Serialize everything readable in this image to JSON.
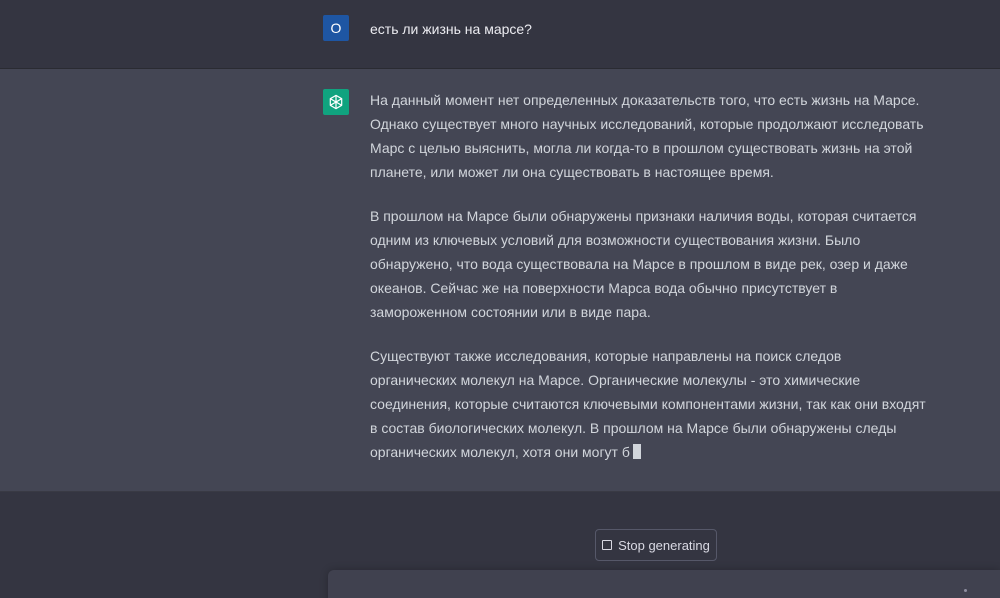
{
  "user_message": {
    "avatar_letter": "O",
    "text": "есть ли жизнь на марсе?"
  },
  "assistant_message": {
    "paragraphs": [
      "На данный момент нет определенных доказательств того, что есть жизнь на Марсе. Однако существует много научных исследований, которые продолжают исследовать Марс с целью выяснить, могла ли когда-то в прошлом существовать жизнь на этой планете, или может ли она существовать в настоящее время.",
      "В прошлом на Марсе были обнаружены признаки наличия воды, которая считается одним из ключевых условий для возможности существования жизни. Было обнаружено, что вода существовала на Марсе в прошлом в виде рек, озер и даже океанов. Сейчас же на поверхности Марса вода обычно присутствует в замороженном состоянии или в виде пара.",
      "Существуют также исследования, которые направлены на поиск следов органических молекул на Марсе. Органические молекулы - это химические соединения, которые считаются ключевыми компонентами жизни, так как они входят в состав биологических молекул. В прошлом на Марсе были обнаружены следы органических молекул, хотя они могут б"
    ]
  },
  "controls": {
    "stop_label": "Stop generating"
  },
  "icons": {
    "assistant_avatar": "openai-logo-icon",
    "stop": "stop-square-icon"
  },
  "colors": {
    "background": "#343541",
    "assistant_background": "#444654",
    "user_avatar": "#1e56a3",
    "assistant_avatar": "#10a37f"
  }
}
